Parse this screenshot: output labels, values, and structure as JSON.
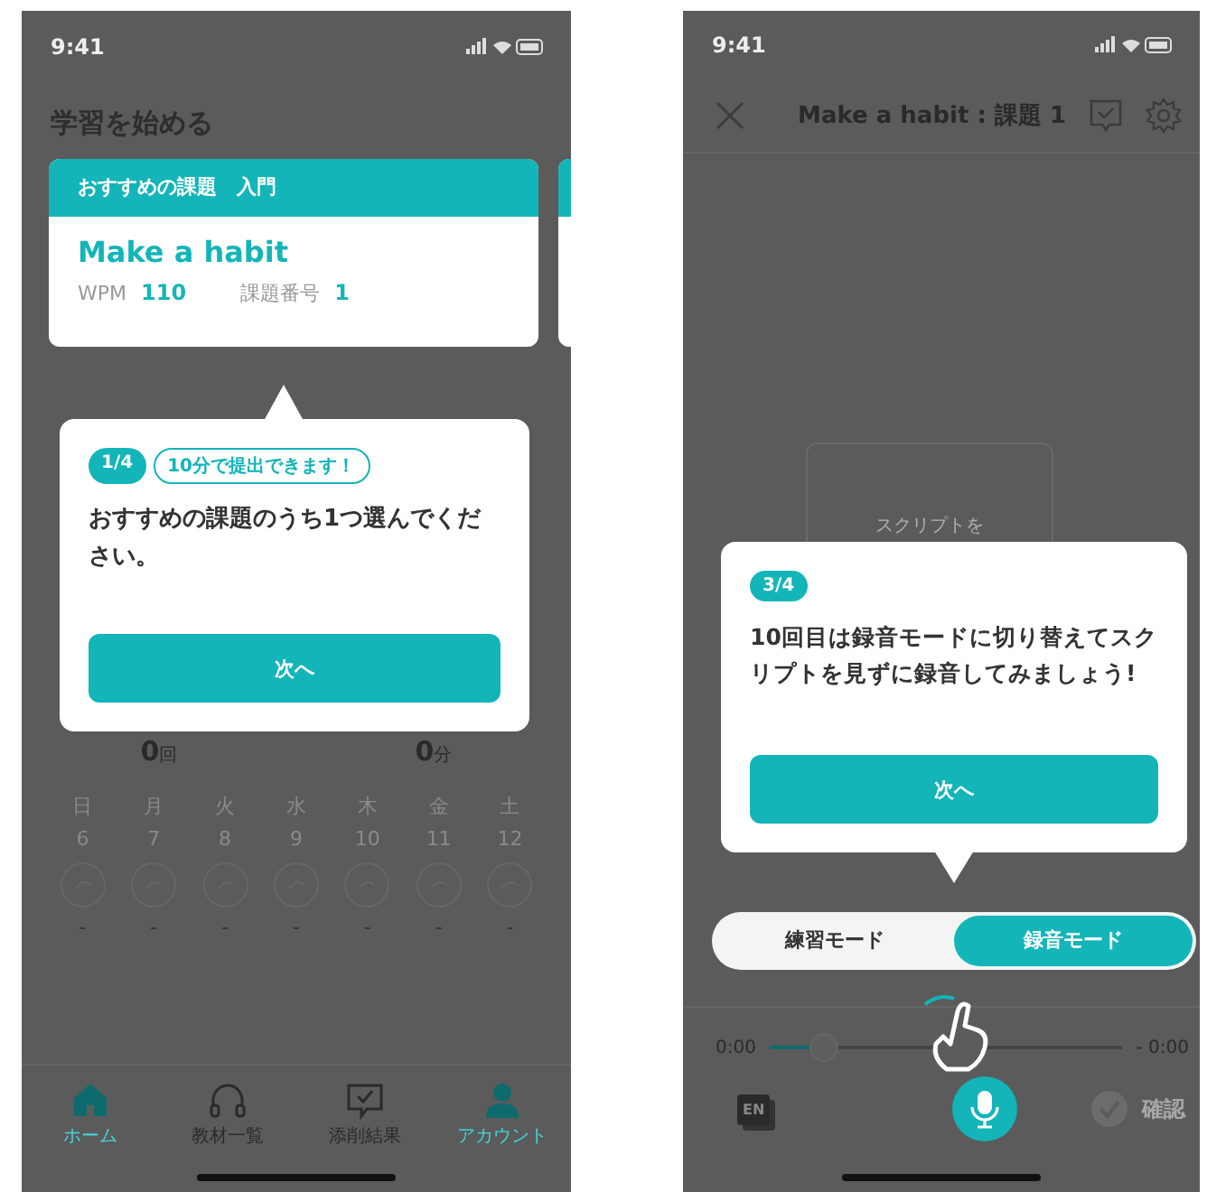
{
  "home_screen": {
    "status_bar": {
      "time": "9:41"
    },
    "section_title": "学習を始める",
    "recommended_card": {
      "header": "おすすめの課題　入門",
      "title": "Make a habit",
      "stats": [
        {
          "label": "WPM",
          "value": "110"
        },
        {
          "label": "課題番号",
          "value": "1"
        }
      ]
    },
    "tutorial": {
      "step": "1/4",
      "tag": "10分で提出できます！",
      "message": "おすすめの課題のうち1つ選んでください。",
      "button": "次へ"
    },
    "totals": [
      {
        "value": "0",
        "unit": "回"
      },
      {
        "value": "0",
        "unit": "分"
      }
    ],
    "week": [
      {
        "day": "日",
        "date": "6",
        "count": "-"
      },
      {
        "day": "月",
        "date": "7",
        "count": "-"
      },
      {
        "day": "火",
        "date": "8",
        "count": "-"
      },
      {
        "day": "水",
        "date": "9",
        "count": "-"
      },
      {
        "day": "木",
        "date": "10",
        "count": "-"
      },
      {
        "day": "金",
        "date": "11",
        "count": "-"
      },
      {
        "day": "土",
        "date": "12",
        "count": "-"
      }
    ],
    "tab_bar": [
      {
        "label": "ホーム",
        "kind": "home",
        "selected": true
      },
      {
        "label": "教材一覧",
        "kind": "headphones",
        "selected": false
      },
      {
        "label": "添削結果",
        "kind": "review",
        "selected": false
      },
      {
        "label": "アカウント",
        "kind": "account",
        "selected": true
      }
    ]
  },
  "recording_screen": {
    "status_bar": {
      "time": "9:41"
    },
    "header": {
      "title": "Make a habit : 課題 1"
    },
    "script_placeholder": "スクリプトを",
    "tutorial": {
      "step": "3/4",
      "message": "10回目は録音モードに切り替えてスクリプトを見ずに録音してみましょう!",
      "button": "次へ"
    },
    "modes": [
      {
        "label": "練習モード",
        "selected": false
      },
      {
        "label": "録音モード",
        "selected": true
      }
    ],
    "player": {
      "elapsed": "0:00",
      "remaining": "- 0:00",
      "level": 0.15
    },
    "language_badge": "EN",
    "confirm": {
      "label": "確認",
      "disabled": true
    }
  }
}
